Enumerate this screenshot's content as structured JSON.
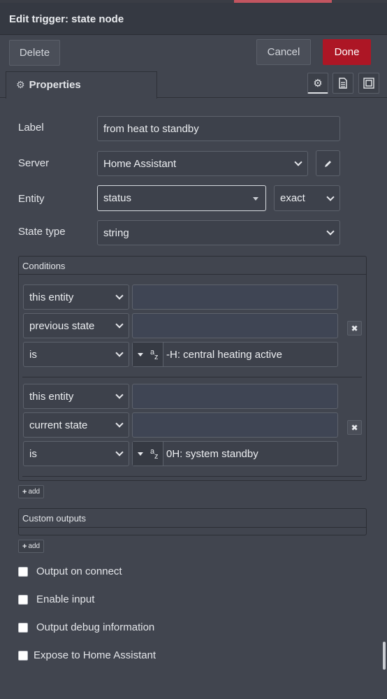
{
  "dialog": {
    "title": "Edit trigger: state node",
    "delete_label": "Delete",
    "cancel_label": "Cancel",
    "done_label": "Done",
    "done_color": "#ad1625"
  },
  "tabs": {
    "properties_label": "Properties",
    "icons": [
      "gear-icon",
      "document-icon",
      "layout-icon"
    ]
  },
  "form": {
    "label_label": "Label",
    "label_value": "from heat to standby",
    "server_label": "Server",
    "server_value": "Home Assistant",
    "entity_label": "Entity",
    "entity_value": "status",
    "entity_match": "exact",
    "state_type_label": "State type",
    "state_type_value": "string"
  },
  "conditions": {
    "header": "Conditions",
    "groups": [
      {
        "target": "this entity",
        "property": "previous state",
        "comparator": "is",
        "value": "-H: central heating active"
      },
      {
        "target": "this entity",
        "property": "current state",
        "comparator": "is",
        "value": "0H: system standby"
      }
    ],
    "add_label": "add",
    "remove_icon": "x-icon"
  },
  "custom_outputs": {
    "header": "Custom outputs",
    "add_label": "add"
  },
  "checkboxes": [
    {
      "label": "Output on connect",
      "checked": false
    },
    {
      "label": "Enable input",
      "checked": false
    },
    {
      "label": "Output debug information",
      "checked": false
    },
    {
      "label": "Expose to Home Assistant",
      "checked": false
    }
  ],
  "type_icon_text": {
    "a": "a",
    "z": "z"
  }
}
